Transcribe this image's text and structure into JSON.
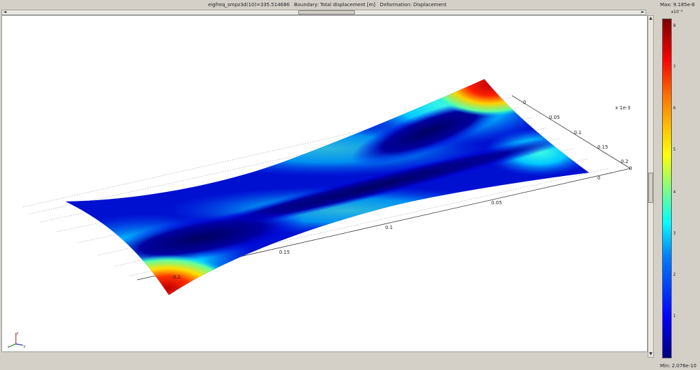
{
  "window": {
    "title": "eigfreq_smpz3d(10)=335.514686   Boundary: Total displacement [m]   Deformation: Displacement"
  },
  "colorbar": {
    "max_label": "Max: 9.185e-8",
    "min_label": "Min: 2.076e-10",
    "exponent_label": "x10⁻⁸",
    "ticks": [
      "8",
      "7",
      "6",
      "5",
      "4",
      "3",
      "2",
      "1"
    ],
    "colors": [
      "#00007f",
      "#0000ff",
      "#00ffff",
      "#ffff00",
      "#ff0000",
      "#7f0000"
    ]
  },
  "plot": {
    "z_magnifier": "x 1e-3",
    "x_axis_ticks": [
      "0",
      "0.05",
      "0.1",
      "0.15",
      "0.2"
    ],
    "y_axis_ticks": [
      "0",
      "0.05",
      "0.1",
      "0.15",
      "0.2"
    ],
    "z_axis_ticks": [
      "0",
      "0"
    ],
    "triad_labels": [
      "z",
      "x",
      "y"
    ]
  },
  "scrollbars": {
    "left_arrow": "◄",
    "right_arrow": "►",
    "up_arrow": "▲",
    "down_arrow": "▼"
  }
}
